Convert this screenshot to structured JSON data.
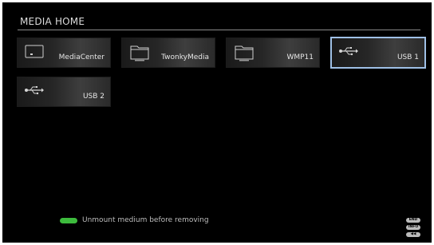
{
  "header": {
    "title": "MEDIA HOME"
  },
  "tiles": [
    {
      "label": "MediaCenter",
      "icon": "monitor-icon",
      "selected": false
    },
    {
      "label": "TwonkyMedia",
      "icon": "folder-icon",
      "selected": false
    },
    {
      "label": "WMP11",
      "icon": "folder-icon",
      "selected": false
    },
    {
      "label": "USB 1",
      "icon": "usb-icon",
      "selected": true
    },
    {
      "label": "USB 2",
      "icon": "usb-icon",
      "selected": false
    }
  ],
  "footer": {
    "hint": "Unmount medium before removing",
    "hint_color": "#3dbb3d",
    "keys": [
      "END",
      "INFO",
      "◀◀"
    ]
  },
  "colors": {
    "selection_border": "#9fc0e6",
    "background": "#000000"
  }
}
